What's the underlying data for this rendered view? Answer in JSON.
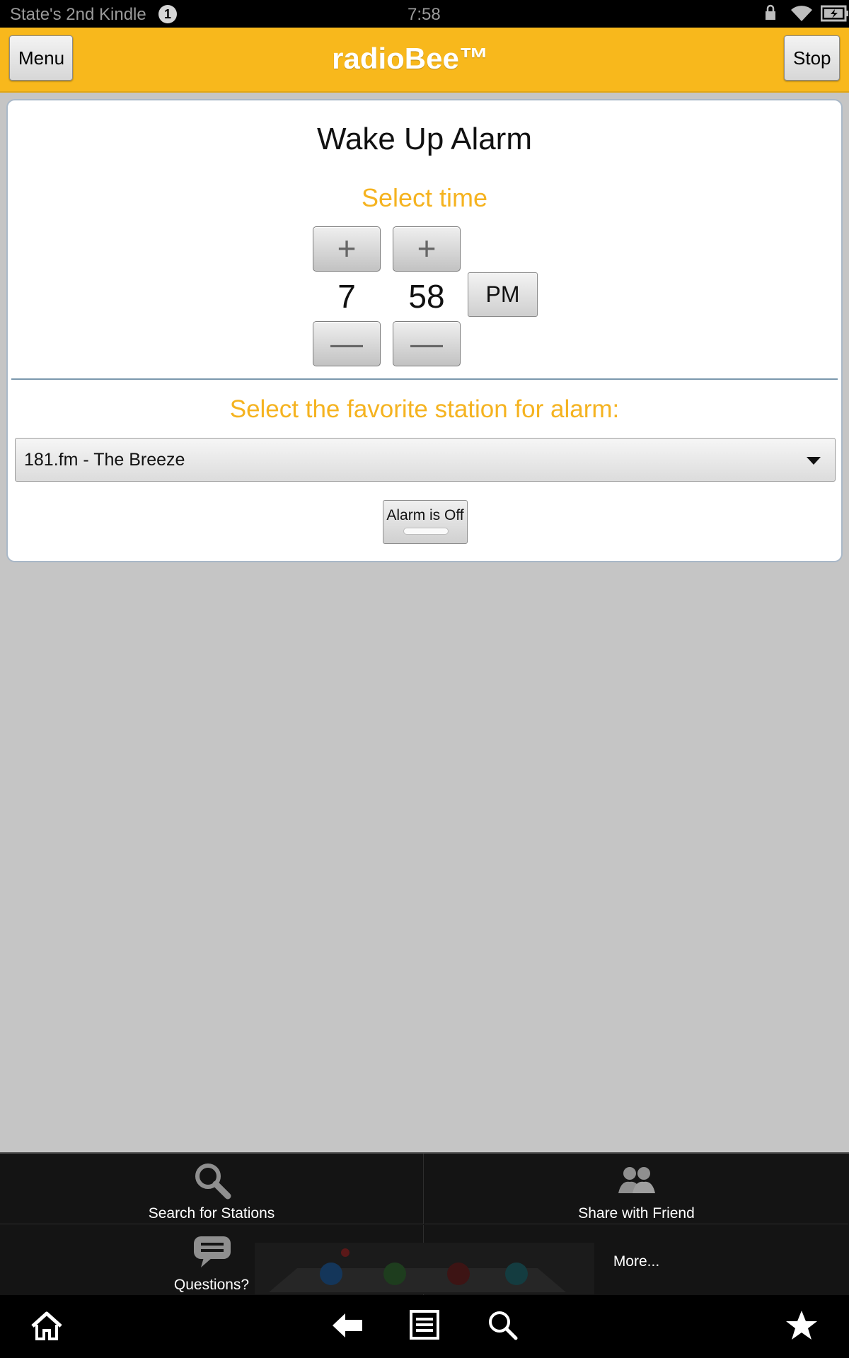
{
  "status_bar": {
    "device_name": "State's 2nd Kindle",
    "notification_count": "1",
    "time": "7:58",
    "icons": [
      "lock-icon",
      "wifi-icon",
      "battery-charging-icon"
    ]
  },
  "header": {
    "menu_label": "Menu",
    "title": "radioBee™",
    "stop_label": "Stop"
  },
  "alarm": {
    "title": "Wake Up Alarm",
    "select_time_label": "Select time",
    "hour": "7",
    "minute": "58",
    "ampm": "PM",
    "plus_symbol": "+",
    "minus_symbol": "—",
    "station_label": "Select the favorite station for alarm:",
    "selected_station": "181.fm - The Breeze",
    "toggle_label": "Alarm is Off",
    "alarm_on": false
  },
  "bottom_menu": {
    "items": [
      {
        "label": "Search for Stations",
        "icon": "search-icon"
      },
      {
        "label": "Share with Friend",
        "icon": "people-icon"
      },
      {
        "label": "Questions?",
        "icon": "chat-bubble-icon"
      },
      {
        "label": "More...",
        "icon": ""
      }
    ]
  },
  "nav_bar": {
    "icons": [
      "home-icon",
      "back-icon",
      "menu-list-icon",
      "search-icon",
      "favorites-star-icon"
    ]
  },
  "colors": {
    "accent": "#f8b81c",
    "accent_text": "#f5b320"
  }
}
